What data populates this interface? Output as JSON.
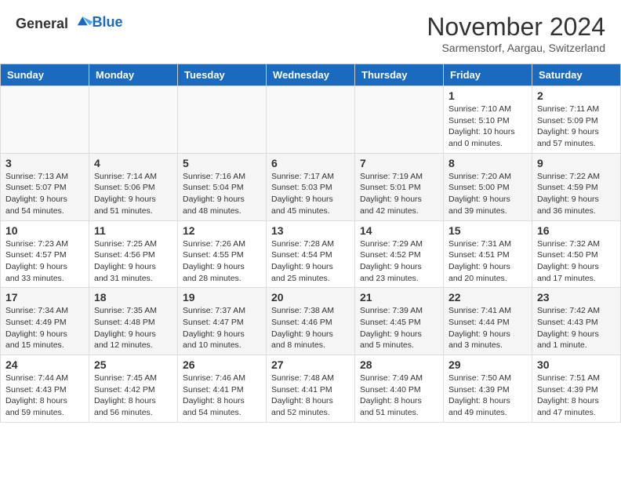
{
  "header": {
    "logo_general": "General",
    "logo_blue": "Blue",
    "title": "November 2024",
    "location": "Sarmenstorf, Aargau, Switzerland"
  },
  "weekdays": [
    "Sunday",
    "Monday",
    "Tuesday",
    "Wednesday",
    "Thursday",
    "Friday",
    "Saturday"
  ],
  "weeks": [
    [
      {
        "day": "",
        "info": ""
      },
      {
        "day": "",
        "info": ""
      },
      {
        "day": "",
        "info": ""
      },
      {
        "day": "",
        "info": ""
      },
      {
        "day": "",
        "info": ""
      },
      {
        "day": "1",
        "info": "Sunrise: 7:10 AM\nSunset: 5:10 PM\nDaylight: 10 hours\nand 0 minutes."
      },
      {
        "day": "2",
        "info": "Sunrise: 7:11 AM\nSunset: 5:09 PM\nDaylight: 9 hours\nand 57 minutes."
      }
    ],
    [
      {
        "day": "3",
        "info": "Sunrise: 7:13 AM\nSunset: 5:07 PM\nDaylight: 9 hours\nand 54 minutes."
      },
      {
        "day": "4",
        "info": "Sunrise: 7:14 AM\nSunset: 5:06 PM\nDaylight: 9 hours\nand 51 minutes."
      },
      {
        "day": "5",
        "info": "Sunrise: 7:16 AM\nSunset: 5:04 PM\nDaylight: 9 hours\nand 48 minutes."
      },
      {
        "day": "6",
        "info": "Sunrise: 7:17 AM\nSunset: 5:03 PM\nDaylight: 9 hours\nand 45 minutes."
      },
      {
        "day": "7",
        "info": "Sunrise: 7:19 AM\nSunset: 5:01 PM\nDaylight: 9 hours\nand 42 minutes."
      },
      {
        "day": "8",
        "info": "Sunrise: 7:20 AM\nSunset: 5:00 PM\nDaylight: 9 hours\nand 39 minutes."
      },
      {
        "day": "9",
        "info": "Sunrise: 7:22 AM\nSunset: 4:59 PM\nDaylight: 9 hours\nand 36 minutes."
      }
    ],
    [
      {
        "day": "10",
        "info": "Sunrise: 7:23 AM\nSunset: 4:57 PM\nDaylight: 9 hours\nand 33 minutes."
      },
      {
        "day": "11",
        "info": "Sunrise: 7:25 AM\nSunset: 4:56 PM\nDaylight: 9 hours\nand 31 minutes."
      },
      {
        "day": "12",
        "info": "Sunrise: 7:26 AM\nSunset: 4:55 PM\nDaylight: 9 hours\nand 28 minutes."
      },
      {
        "day": "13",
        "info": "Sunrise: 7:28 AM\nSunset: 4:54 PM\nDaylight: 9 hours\nand 25 minutes."
      },
      {
        "day": "14",
        "info": "Sunrise: 7:29 AM\nSunset: 4:52 PM\nDaylight: 9 hours\nand 23 minutes."
      },
      {
        "day": "15",
        "info": "Sunrise: 7:31 AM\nSunset: 4:51 PM\nDaylight: 9 hours\nand 20 minutes."
      },
      {
        "day": "16",
        "info": "Sunrise: 7:32 AM\nSunset: 4:50 PM\nDaylight: 9 hours\nand 17 minutes."
      }
    ],
    [
      {
        "day": "17",
        "info": "Sunrise: 7:34 AM\nSunset: 4:49 PM\nDaylight: 9 hours\nand 15 minutes."
      },
      {
        "day": "18",
        "info": "Sunrise: 7:35 AM\nSunset: 4:48 PM\nDaylight: 9 hours\nand 12 minutes."
      },
      {
        "day": "19",
        "info": "Sunrise: 7:37 AM\nSunset: 4:47 PM\nDaylight: 9 hours\nand 10 minutes."
      },
      {
        "day": "20",
        "info": "Sunrise: 7:38 AM\nSunset: 4:46 PM\nDaylight: 9 hours\nand 8 minutes."
      },
      {
        "day": "21",
        "info": "Sunrise: 7:39 AM\nSunset: 4:45 PM\nDaylight: 9 hours\nand 5 minutes."
      },
      {
        "day": "22",
        "info": "Sunrise: 7:41 AM\nSunset: 4:44 PM\nDaylight: 9 hours\nand 3 minutes."
      },
      {
        "day": "23",
        "info": "Sunrise: 7:42 AM\nSunset: 4:43 PM\nDaylight: 9 hours\nand 1 minute."
      }
    ],
    [
      {
        "day": "24",
        "info": "Sunrise: 7:44 AM\nSunset: 4:43 PM\nDaylight: 8 hours\nand 59 minutes."
      },
      {
        "day": "25",
        "info": "Sunrise: 7:45 AM\nSunset: 4:42 PM\nDaylight: 8 hours\nand 56 minutes."
      },
      {
        "day": "26",
        "info": "Sunrise: 7:46 AM\nSunset: 4:41 PM\nDaylight: 8 hours\nand 54 minutes."
      },
      {
        "day": "27",
        "info": "Sunrise: 7:48 AM\nSunset: 4:41 PM\nDaylight: 8 hours\nand 52 minutes."
      },
      {
        "day": "28",
        "info": "Sunrise: 7:49 AM\nSunset: 4:40 PM\nDaylight: 8 hours\nand 51 minutes."
      },
      {
        "day": "29",
        "info": "Sunrise: 7:50 AM\nSunset: 4:39 PM\nDaylight: 8 hours\nand 49 minutes."
      },
      {
        "day": "30",
        "info": "Sunrise: 7:51 AM\nSunset: 4:39 PM\nDaylight: 8 hours\nand 47 minutes."
      }
    ]
  ]
}
